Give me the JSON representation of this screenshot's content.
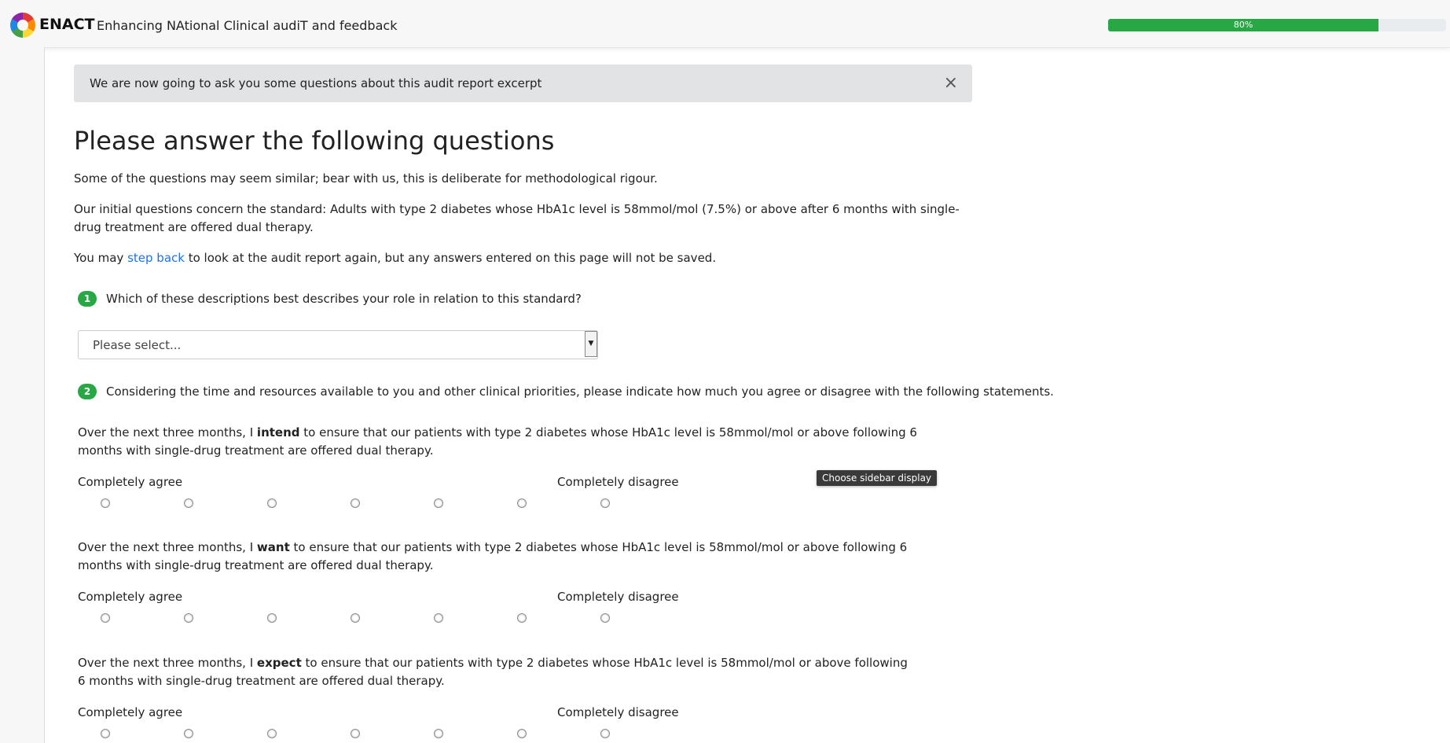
{
  "header": {
    "brand": "ENACT",
    "tagline": "Enhancing NAtional Clinical audiT and feedback",
    "progress_percent": 80,
    "progress_label": "80%"
  },
  "alert": {
    "message": "We are now going to ask you some questions about this audit report excerpt",
    "close_glyph": "×"
  },
  "page": {
    "title": "Please answer the following questions",
    "intro": "Some of the questions may seem similar; bear with us, this is deliberate for methodological rigour.",
    "standard_text": "Our initial questions concern the standard: Adults with type 2 diabetes whose HbA1c level is 58mmol/mol (7.5%) or above after 6 months with single-drug treatment are offered dual therapy.",
    "stepback_prefix": "You may ",
    "stepback_link": "step back",
    "stepback_suffix": " to look at the audit report again, but any answers entered on this page will not be saved."
  },
  "questions": [
    {
      "number": "1",
      "text": "Which of these descriptions best describes your role in relation to this standard?",
      "select_value": "Please select..."
    },
    {
      "number": "2",
      "text": "Considering the time and resources available to you and other clinical priorities, please indicate how much you agree or disagree with the following statements."
    }
  ],
  "statements": [
    {
      "prefix": "Over the next three months, I ",
      "verb": "intend",
      "suffix": " to ensure that our patients with type 2 diabetes whose HbA1c level is 58mmol/mol or above following 6 months with single-drug treatment are offered dual therapy."
    },
    {
      "prefix": "Over the next three months, I ",
      "verb": "want",
      "suffix": " to ensure that our patients with type 2 diabetes whose HbA1c level is 58mmol/mol or above following 6 months with single-drug treatment are offered dual therapy."
    },
    {
      "prefix": "Over the next three months, I ",
      "verb": "expect",
      "suffix": " to ensure that our patients with type 2 diabetes whose HbA1c level is 58mmol/mol or above following 6 months with single-drug treatment are offered dual therapy."
    }
  ],
  "scale": {
    "left_label": "Completely agree",
    "right_label": "Completely disagree",
    "points": 7
  },
  "tooltip": "Choose sidebar display",
  "colors": {
    "accent_green": "#28a745",
    "link_blue": "#1a73e8",
    "alert_bg": "#e2e3e5"
  }
}
